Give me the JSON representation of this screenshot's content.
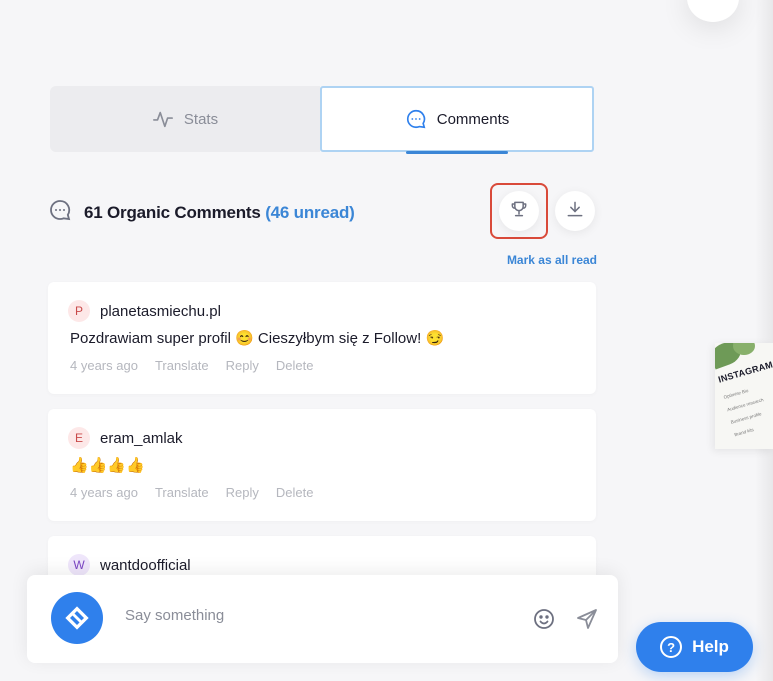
{
  "tabs": {
    "stats_label": "Stats",
    "comments_label": "Comments"
  },
  "header": {
    "count_label": "61 Organic Comments",
    "unread_label": "(46 unread)",
    "mark_all_read": "Mark as all read"
  },
  "comments": [
    {
      "initial": "P",
      "username": "planetasmiechu.pl",
      "text": "Pozdrawiam super profil 😊 Cieszyłbym się z Follow! 😏",
      "time": "4 years ago",
      "translate": "Translate",
      "reply": "Reply",
      "delete": "Delete"
    },
    {
      "initial": "E",
      "username": "eram_amlak",
      "text": "👍👍👍👍",
      "time": "4 years ago",
      "translate": "Translate",
      "reply": "Reply",
      "delete": "Delete"
    },
    {
      "initial": "W",
      "username": "wantdoofficial"
    }
  ],
  "composer": {
    "placeholder": "Say something"
  },
  "thumbnail": {
    "title": "INSTAGRAM",
    "items": [
      "Optimise Bio",
      "Audience research",
      "Business profile",
      "Brand kits"
    ]
  },
  "help": {
    "label": "Help",
    "icon_glyph": "?"
  },
  "colors": {
    "accent": "#3b86d6",
    "brand_blue": "#2f80ec",
    "highlight_red": "#d94a3a"
  }
}
